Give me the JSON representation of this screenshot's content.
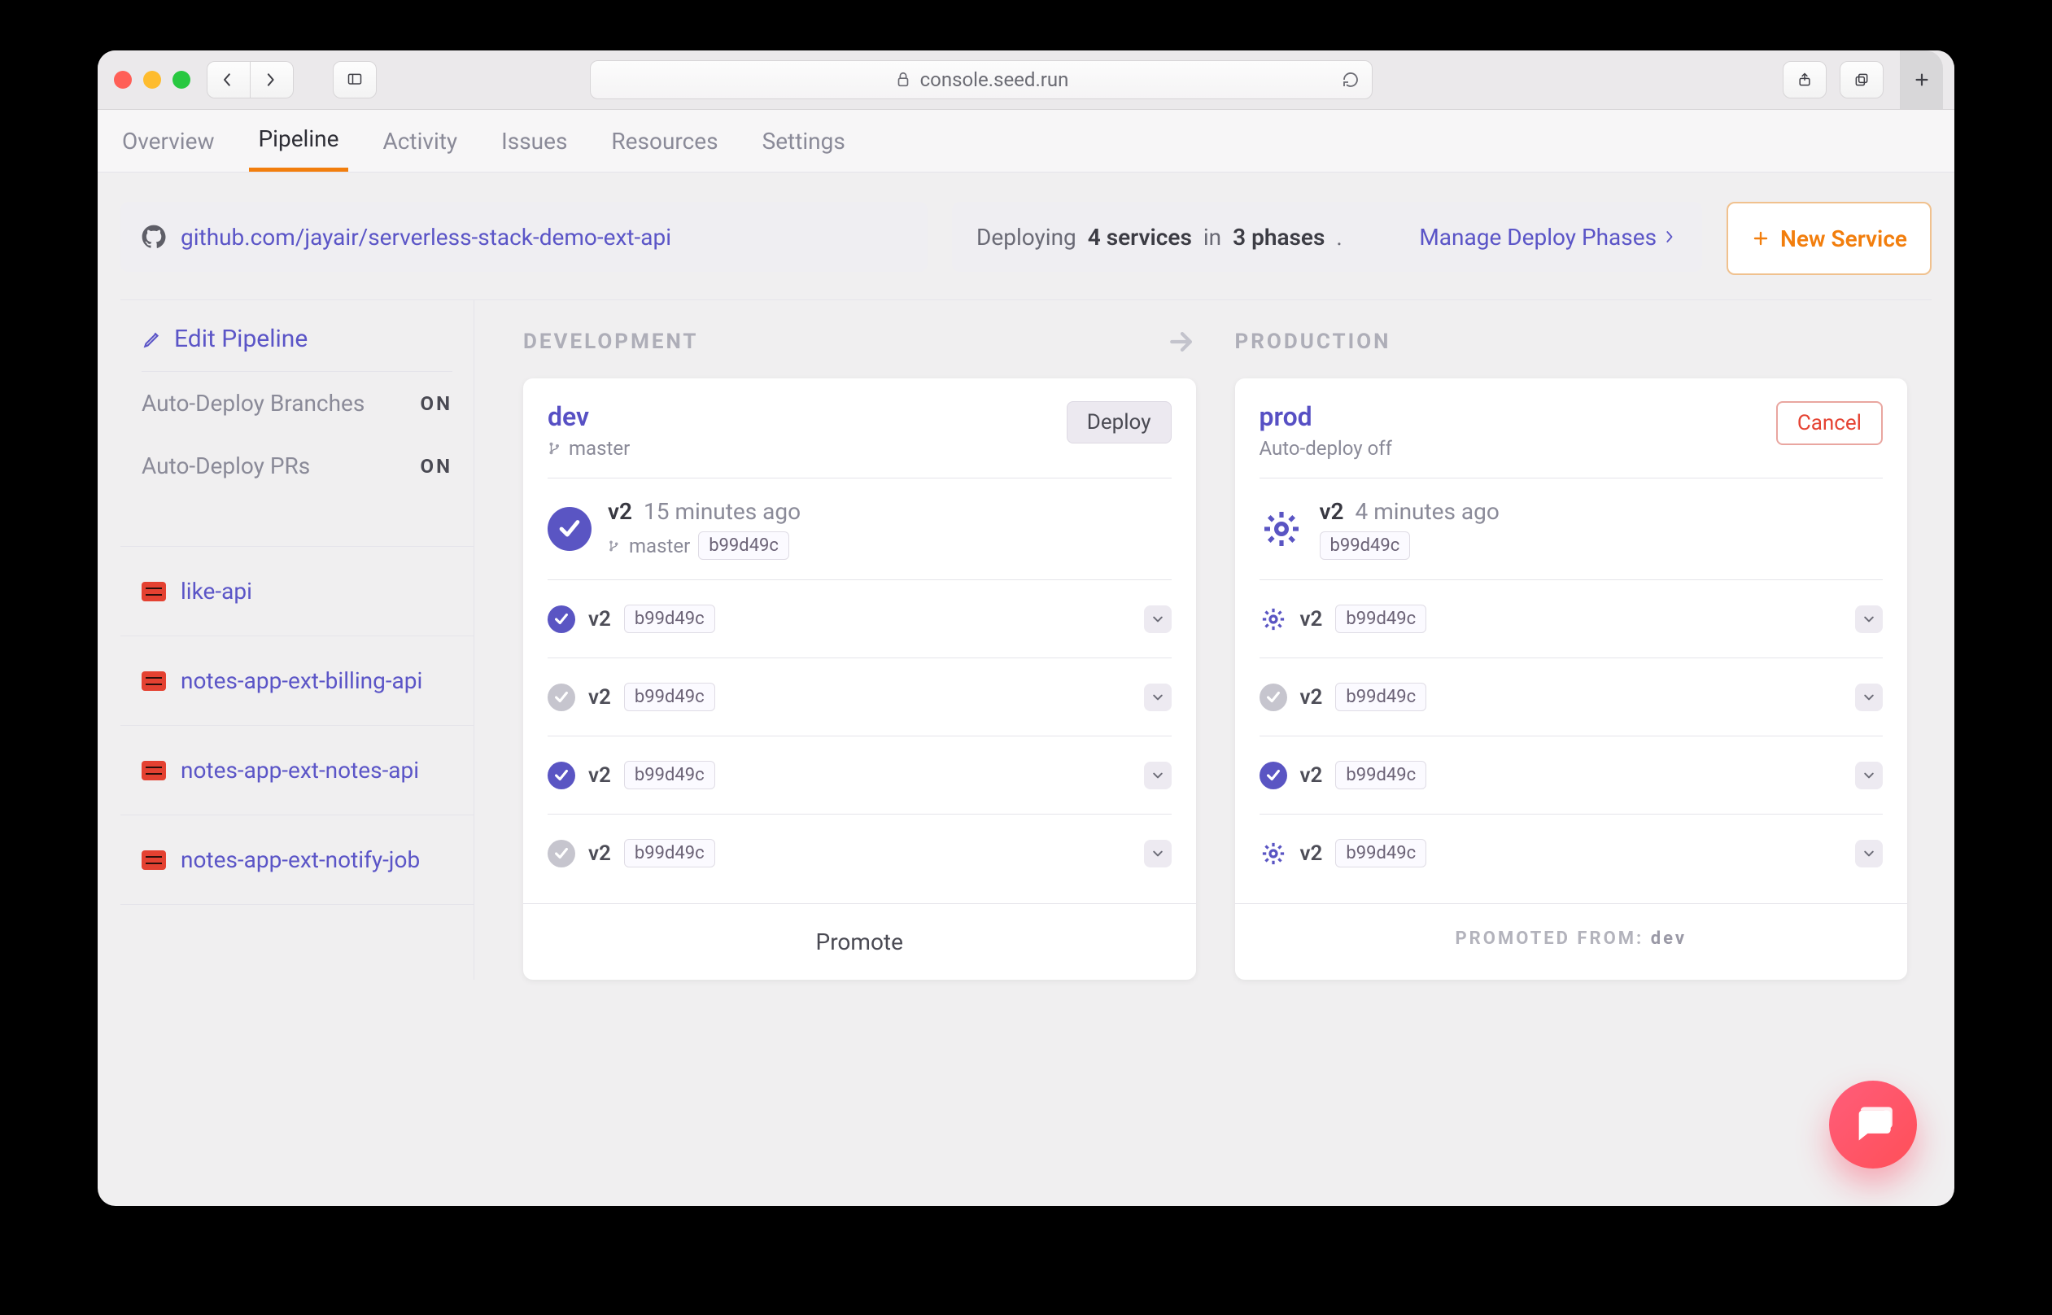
{
  "browser": {
    "address": "console.seed.run"
  },
  "tabs": [
    "Overview",
    "Pipeline",
    "Activity",
    "Issues",
    "Resources",
    "Settings"
  ],
  "active_tab": "Pipeline",
  "repo": "github.com/jayair/serverless-stack-demo-ext-api",
  "deploy_summary": {
    "prefix": "Deploying",
    "services": "4 services",
    "mid": "in",
    "phases": "3 phases",
    "suffix": "."
  },
  "manage_phases_label": "Manage Deploy Phases",
  "new_service_label": "New Service",
  "sidebar": {
    "edit_label": "Edit Pipeline",
    "options": [
      {
        "label": "Auto-Deploy Branches",
        "value": "ON"
      },
      {
        "label": "Auto-Deploy PRs",
        "value": "ON"
      }
    ],
    "services": [
      "like-api",
      "notes-app-ext-billing-api",
      "notes-app-ext-notes-api",
      "notes-app-ext-notify-job"
    ]
  },
  "columns": {
    "dev": {
      "column_label": "DEVELOPMENT",
      "title": "dev",
      "branch": "master",
      "action": "Deploy",
      "summary": {
        "icon": "check",
        "version": "v2",
        "time": "15 minutes ago",
        "branch": "master",
        "commit": "b99d49c"
      },
      "rows": [
        {
          "icon": "check-purple",
          "version": "v2",
          "commit": "b99d49c"
        },
        {
          "icon": "check-grey",
          "version": "v2",
          "commit": "b99d49c"
        },
        {
          "icon": "check-purple",
          "version": "v2",
          "commit": "b99d49c"
        },
        {
          "icon": "check-grey",
          "version": "v2",
          "commit": "b99d49c"
        }
      ],
      "footer": "Promote"
    },
    "prod": {
      "column_label": "PRODUCTION",
      "title": "prod",
      "sub": "Auto-deploy off",
      "action": "Cancel",
      "summary": {
        "icon": "gear",
        "version": "v2",
        "time": "4 minutes ago",
        "commit": "b99d49c"
      },
      "rows": [
        {
          "icon": "gear-purple",
          "version": "v2",
          "commit": "b99d49c"
        },
        {
          "icon": "check-grey",
          "version": "v2",
          "commit": "b99d49c"
        },
        {
          "icon": "check-purple",
          "version": "v2",
          "commit": "b99d49c"
        },
        {
          "icon": "gear-purple",
          "version": "v2",
          "commit": "b99d49c"
        }
      ],
      "footer_prefix": "PROMOTED FROM:",
      "footer_value": "dev"
    }
  }
}
